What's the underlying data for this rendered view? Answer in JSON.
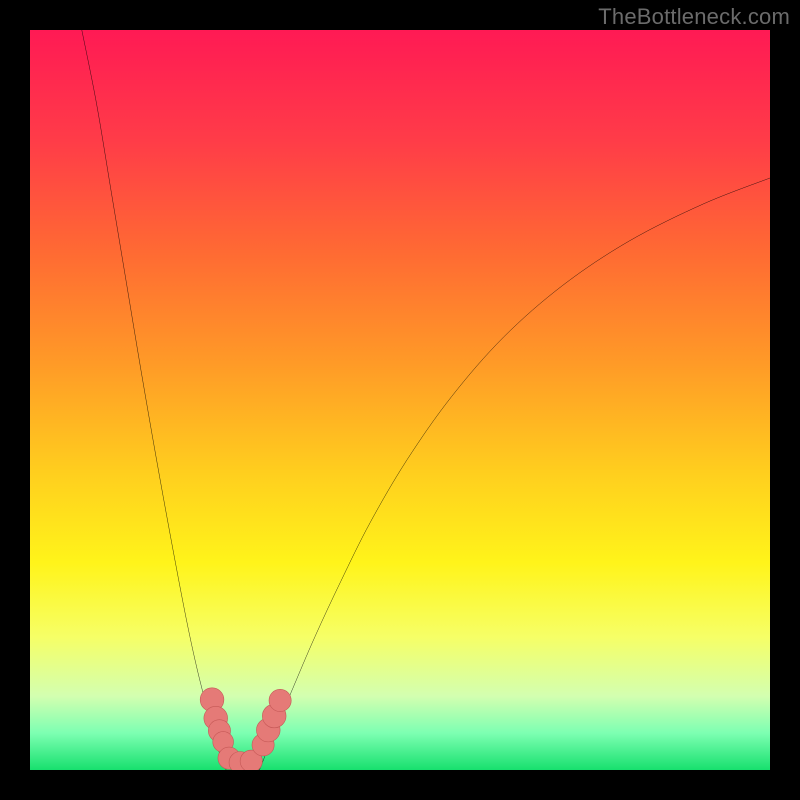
{
  "watermark": "TheBottleneck.com",
  "chart_data": {
    "type": "line",
    "title": "",
    "xlabel": "",
    "ylabel": "",
    "xlim": [
      0,
      100
    ],
    "ylim": [
      0,
      100
    ],
    "grid": false,
    "legend": false,
    "background_gradient": {
      "stops": [
        {
          "offset": 0.0,
          "color": "#ff1a54"
        },
        {
          "offset": 0.15,
          "color": "#ff3c48"
        },
        {
          "offset": 0.3,
          "color": "#ff6a33"
        },
        {
          "offset": 0.45,
          "color": "#ff9a27"
        },
        {
          "offset": 0.6,
          "color": "#ffcf1e"
        },
        {
          "offset": 0.72,
          "color": "#fff41a"
        },
        {
          "offset": 0.82,
          "color": "#f6ff66"
        },
        {
          "offset": 0.9,
          "color": "#d3ffb0"
        },
        {
          "offset": 0.95,
          "color": "#7dffb2"
        },
        {
          "offset": 1.0,
          "color": "#17e06e"
        }
      ]
    },
    "series": [
      {
        "name": "left-curve",
        "color": "#000000",
        "x": [
          7.0,
          9.0,
          11.0,
          13.0,
          15.0,
          17.0,
          19.0,
          21.0,
          22.5,
          24.0,
          25.0,
          26.5
        ],
        "y": [
          100.0,
          90.0,
          78.0,
          66.0,
          54.0,
          42.5,
          31.5,
          21.0,
          14.0,
          8.0,
          4.0,
          0.0
        ]
      },
      {
        "name": "right-curve",
        "color": "#000000",
        "x": [
          31.0,
          33.0,
          35.5,
          38.5,
          42.0,
          46.0,
          51.0,
          57.0,
          64.0,
          72.0,
          81.0,
          91.0,
          100.0
        ],
        "y": [
          0.0,
          5.0,
          11.0,
          18.0,
          25.5,
          33.5,
          42.0,
          50.5,
          58.5,
          65.5,
          71.5,
          76.5,
          80.0
        ]
      },
      {
        "name": "trough-floor",
        "color": "#000000",
        "x": [
          25.8,
          27.0,
          28.3,
          29.7,
          31.0
        ],
        "y": [
          1.2,
          0.5,
          0.3,
          0.5,
          1.2
        ]
      }
    ],
    "markers": [
      {
        "name": "left-cluster-top",
        "x": 24.6,
        "y": 9.5,
        "r": 1.6
      },
      {
        "name": "left-cluster-upper",
        "x": 25.1,
        "y": 7.0,
        "r": 1.6
      },
      {
        "name": "left-cluster-mid",
        "x": 25.6,
        "y": 5.3,
        "r": 1.5
      },
      {
        "name": "left-cluster-low",
        "x": 26.1,
        "y": 3.8,
        "r": 1.4
      },
      {
        "name": "trough-marker-1",
        "x": 26.9,
        "y": 1.6,
        "r": 1.5
      },
      {
        "name": "trough-marker-2",
        "x": 28.4,
        "y": 1.0,
        "r": 1.5
      },
      {
        "name": "trough-marker-3",
        "x": 29.9,
        "y": 1.2,
        "r": 1.5
      },
      {
        "name": "right-cluster-low",
        "x": 31.5,
        "y": 3.4,
        "r": 1.5
      },
      {
        "name": "right-cluster-mid",
        "x": 32.2,
        "y": 5.4,
        "r": 1.6
      },
      {
        "name": "right-cluster-upper",
        "x": 33.0,
        "y": 7.3,
        "r": 1.6
      },
      {
        "name": "right-cluster-top",
        "x": 33.8,
        "y": 9.4,
        "r": 1.5
      }
    ],
    "marker_style": {
      "fill": "#e57a77",
      "stroke": "#c55856",
      "stroke_width": 0.6
    }
  }
}
